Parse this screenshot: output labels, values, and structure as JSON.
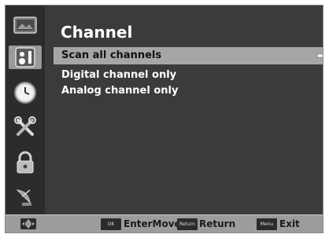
{
  "screen": {
    "title": "Channel"
  },
  "sidebar": {
    "items": [
      {
        "icon": "picture-icon"
      },
      {
        "icon": "audio-icon",
        "active": true
      },
      {
        "icon": "clock-icon"
      },
      {
        "icon": "setup-tools-icon"
      },
      {
        "icon": "lock-icon"
      },
      {
        "icon": "satellite-dish-icon"
      }
    ]
  },
  "menu": {
    "items": [
      {
        "label": "Scan all channels",
        "selected": true
      },
      {
        "label": "Digital channel only"
      },
      {
        "label": "Analog channel only"
      }
    ]
  },
  "footer": {
    "ok_key": "OK",
    "enter_move_label": "EnterMove",
    "return_key": "Return",
    "return_label": "Return",
    "menu_key": "Menu",
    "exit_label": "Exit"
  },
  "colors": {
    "background": "#3b3b3b",
    "selection": "#a6a6a6",
    "footer": "#9c9c9c"
  }
}
